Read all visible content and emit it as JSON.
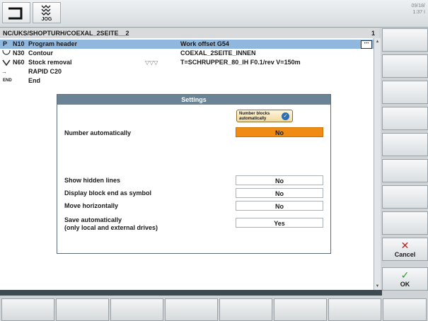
{
  "header": {
    "mode_label": "JOG",
    "clock_lines": [
      "09/18/",
      "1:37 I"
    ]
  },
  "editor": {
    "path": "NC/UKS/SHOPTURH/COEXAL_2SEITE__2",
    "path_number": "1",
    "rows": [
      {
        "tag": "P",
        "num": "N10",
        "text": "Program header",
        "right": "Work offset G54",
        "selected": true
      },
      {
        "tag": "",
        "num": "N30",
        "text": "Contour",
        "right": "COEXAL_2SEITE_INNEN"
      },
      {
        "tag": "",
        "num": "N60",
        "text": "Stock removal",
        "mid": "▽▽▽",
        "right": "T=SCHRUPPER_80_IH F0.1/rev V=150m"
      },
      {
        "tag": "",
        "num": "",
        "text": "RAPID C20",
        "right": ""
      },
      {
        "tag": "END",
        "num": "",
        "text": "End",
        "right": ""
      }
    ],
    "more_button": "⋯"
  },
  "dialog": {
    "title": "Settings",
    "badge_text": "Number blocks automatically",
    "badge_icon": "ok-icon",
    "settings": [
      {
        "label": "Number automatically",
        "value": "No",
        "active": true
      },
      {
        "label": "Show hidden lines",
        "value": "No"
      },
      {
        "label": "Display block end as symbol",
        "value": "No"
      },
      {
        "label": "Move horizontally",
        "value": "No"
      },
      {
        "label": "Save automatically",
        "label2": "(only local and external drives)",
        "value": "Yes"
      }
    ]
  },
  "softkeys": {
    "cancel": {
      "label": "Cancel",
      "symbol": "✕",
      "color": "#c41a1a"
    },
    "ok": {
      "label": "OK",
      "symbol": "✓",
      "color": "#2f9a2f"
    }
  },
  "colors": {
    "selection": "#90b7dd",
    "dialog_title_bg": "#6a8496",
    "active_value": "#f08c14"
  }
}
